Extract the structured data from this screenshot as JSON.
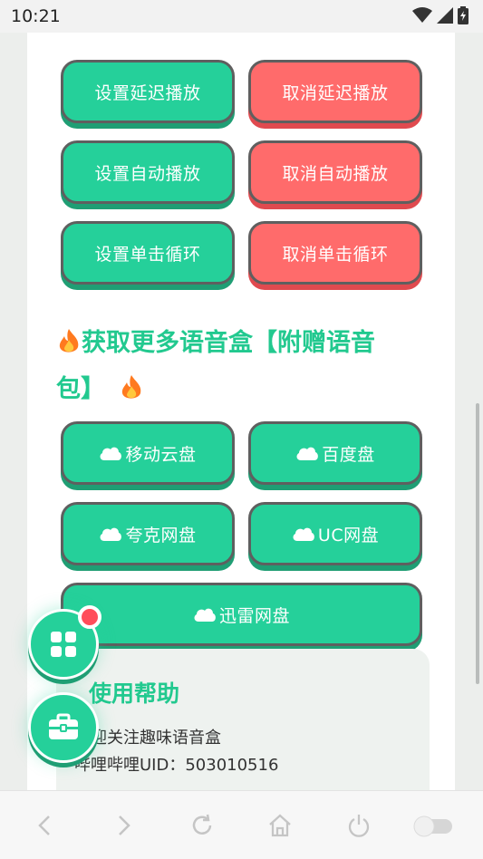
{
  "status_bar": {
    "time": "10:21"
  },
  "delay_controls": {
    "set_delay": "设置延迟播放",
    "cancel_delay": "取消延迟播放",
    "set_auto": "设置自动播放",
    "cancel_auto": "取消自动播放",
    "set_loop": "设置单击循环",
    "cancel_loop": "取消单击循环"
  },
  "more_section": {
    "title": "获取更多语音盒【附赠语音包】"
  },
  "downloads": {
    "mobile_cloud": "移动云盘",
    "baidu": "百度盘",
    "quark": "夸克网盘",
    "uc": "UC网盘",
    "xunlei": "迅雷网盘"
  },
  "help": {
    "title": "使用帮助",
    "line1": "欢迎关注趣味语音盒",
    "line2": "哔哩哔哩UID：503010516"
  },
  "colors": {
    "green": "#25d09a",
    "red": "#ff6b6b",
    "accent_text": "#22c98f"
  },
  "icons": {
    "fab_top": "grid-icon",
    "fab_bottom": "toolbox-icon",
    "cloud": "cloud-icon",
    "fire": "fire-icon"
  }
}
